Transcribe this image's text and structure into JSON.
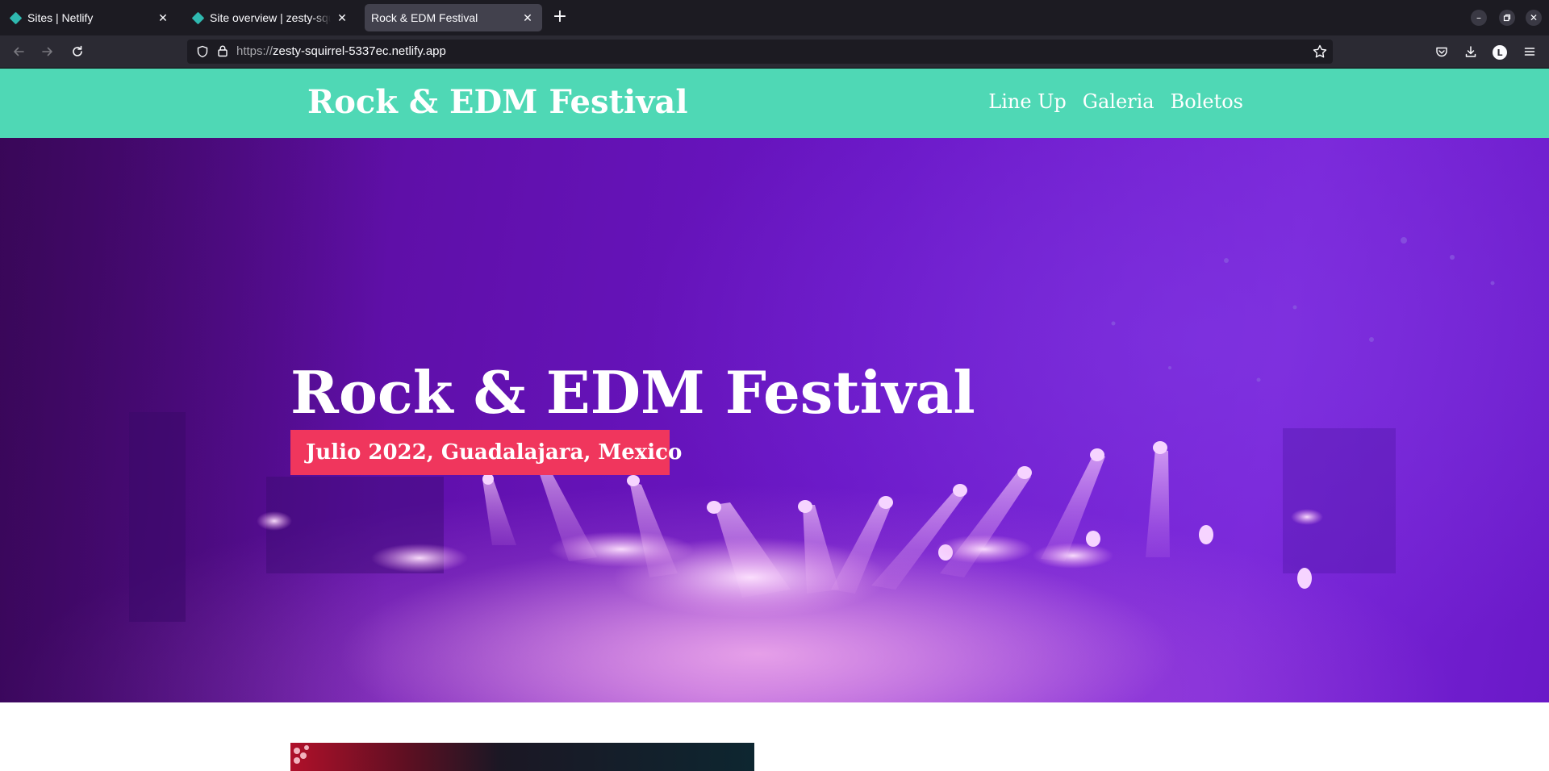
{
  "browser": {
    "tabs": [
      {
        "title": "Sites | Netlify",
        "active": false
      },
      {
        "title": "Site overview | zesty-squirrel",
        "active": false
      },
      {
        "title": "Rock & EDM Festival",
        "active": true
      }
    ],
    "url_scheme": "https://",
    "url_host": "zesty-squirrel-5337ec.netlify.app",
    "profile_initial": "L"
  },
  "site": {
    "logo": "Rock & EDM Festival",
    "nav": [
      "Line Up",
      "Galeria",
      "Boletos"
    ],
    "hero": {
      "title": "Rock & EDM Festival",
      "subtitle": "Julio 2022, Guadalajara, Mexico"
    },
    "colors": {
      "header_bg": "#4fd8b5",
      "badge_bg": "#f0365d",
      "hero_tint": "#6a16c6"
    }
  }
}
